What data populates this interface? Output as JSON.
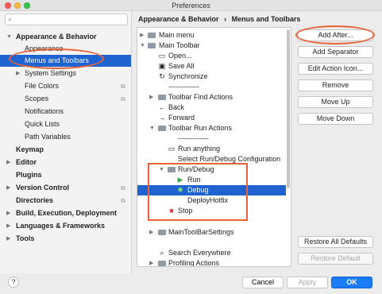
{
  "window": {
    "title": "Preferences"
  },
  "search": {
    "placeholder": ""
  },
  "sidebar": {
    "items": [
      {
        "label": "Appearance & Behavior"
      },
      {
        "label": "Appearance"
      },
      {
        "label": "Menus and Toolbars"
      },
      {
        "label": "System Settings"
      },
      {
        "label": "File Colors"
      },
      {
        "label": "Scopes"
      },
      {
        "label": "Notifications"
      },
      {
        "label": "Quick Lists"
      },
      {
        "label": "Path Variables"
      },
      {
        "label": "Keymap"
      },
      {
        "label": "Editor"
      },
      {
        "label": "Plugins"
      },
      {
        "label": "Version Control"
      },
      {
        "label": "Directories"
      },
      {
        "label": "Build, Execution, Deployment"
      },
      {
        "label": "Languages & Frameworks"
      },
      {
        "label": "Tools"
      }
    ]
  },
  "breadcrumb": {
    "parent": "Appearance & Behavior",
    "separator": "›",
    "current": "Menus and Toolbars"
  },
  "tree": {
    "rows": [
      {
        "label": "Main menu"
      },
      {
        "label": "Main Toolbar"
      },
      {
        "label": "Open..."
      },
      {
        "label": "Save All"
      },
      {
        "label": "Synchronize"
      },
      {
        "label": "-------------"
      },
      {
        "label": "Toolbar Find Actions"
      },
      {
        "label": "Back"
      },
      {
        "label": "Forward"
      },
      {
        "label": "Toolbar Run Actions"
      },
      {
        "label": "-------------"
      },
      {
        "label": "Run anything"
      },
      {
        "label": "Select Run/Debug Configuration"
      },
      {
        "label": "Run/Debug"
      },
      {
        "label": "Run"
      },
      {
        "label": "Debug"
      },
      {
        "label": "DeployHotfix"
      },
      {
        "label": "Stop"
      },
      {
        "label": "MainToolBarSettings"
      },
      {
        "label": "Search Everywhere"
      },
      {
        "label": "Profiling Actions"
      }
    ]
  },
  "actions": {
    "add_after": "Add After...",
    "add_separator": "Add Separator",
    "edit_icon": "Edit Action Icon...",
    "remove": "Remove",
    "move_up": "Move Up",
    "move_down": "Move Down",
    "restore_all": "Restore All Defaults",
    "restore_default": "Restore Default"
  },
  "footer": {
    "help": "?",
    "cancel": "Cancel",
    "apply": "Apply",
    "ok": "OK"
  },
  "icons": {
    "search": "⌕",
    "arrow_right": "▶",
    "arrow_down": "▼",
    "open": "▭",
    "save": "▣",
    "sync": "↻",
    "back": "←",
    "forward": "→",
    "run_anything": "▭",
    "run": "▶",
    "debug": "✹",
    "stop": "■",
    "search_everywhere": "⌕",
    "copy": "⧉"
  },
  "colors": {
    "selection": "#1f63d1",
    "annotation": "#e8633a",
    "run": "#3aa54a",
    "stop": "#d9434b",
    "ok": "#1a7cf6"
  }
}
